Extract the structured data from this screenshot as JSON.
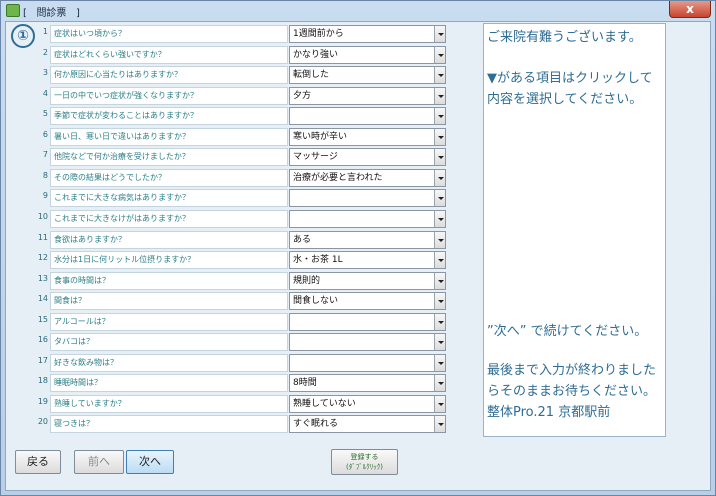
{
  "window": {
    "title": "[   問診票   ]",
    "close_label": "x"
  },
  "step_badge": "①",
  "questions": [
    {
      "num": "1",
      "label": "症状はいつ頃から？",
      "value": "1週間前から"
    },
    {
      "num": "2",
      "label": "症状はどれくらい強いですか？",
      "value": "かなり強い"
    },
    {
      "num": "3",
      "label": "何か原因に心当たりはありますか？",
      "value": "転倒した"
    },
    {
      "num": "4",
      "label": "一日の中でいつ症状が強くなりますか？",
      "value": "夕方"
    },
    {
      "num": "5",
      "label": "季節で症状が変わることはありますか？",
      "value": ""
    },
    {
      "num": "6",
      "label": "暑い日、寒い日で違いはありますか？",
      "value": "寒い時が辛い"
    },
    {
      "num": "7",
      "label": "他院などで何か治療を受けましたか？",
      "value": "マッサージ"
    },
    {
      "num": "8",
      "label": "その際の結果はどうでしたか？",
      "value": "治療が必要と言われた"
    },
    {
      "num": "9",
      "label": "これまでに大きな病気はありますか？",
      "value": ""
    },
    {
      "num": "10",
      "label": "これまでに大きなけがはありますか？",
      "value": ""
    },
    {
      "num": "11",
      "label": "食欲はありますか？",
      "value": "ある"
    },
    {
      "num": "12",
      "label": "水分は1日に何リットル位摂りますか？",
      "value": "水・お茶 1L"
    },
    {
      "num": "13",
      "label": "食事の時間は？",
      "value": "規則的"
    },
    {
      "num": "14",
      "label": "間食は？",
      "value": "間食しない"
    },
    {
      "num": "15",
      "label": "アルコールは？",
      "value": ""
    },
    {
      "num": "16",
      "label": "タバコは？",
      "value": ""
    },
    {
      "num": "17",
      "label": "好きな飲み物は？",
      "value": ""
    },
    {
      "num": "18",
      "label": "睡眠時間は？",
      "value": "8時間"
    },
    {
      "num": "19",
      "label": "熟睡していますか？",
      "value": "熟睡していない"
    },
    {
      "num": "20",
      "label": "寝つきは？",
      "value": "すぐ眠れる"
    }
  ],
  "info": {
    "welcome": "ご来院有難うございます。",
    "instruction_1": "▼がある項目はクリックして",
    "instruction_2": "内容を選択してください。",
    "next_hint": "”次へ” で続けてください。",
    "finish_1": "最後まで入力が終わりました",
    "finish_2": "らそのままお待ちください。",
    "clinic": "整体Pro.21 京都駅前"
  },
  "buttons": {
    "back": "戻る",
    "prev": "前へ",
    "next": "次へ",
    "register_1": "登録する",
    "register_2": "(ﾀﾞﾌﾞﾙｸﾘｯｸ)"
  }
}
